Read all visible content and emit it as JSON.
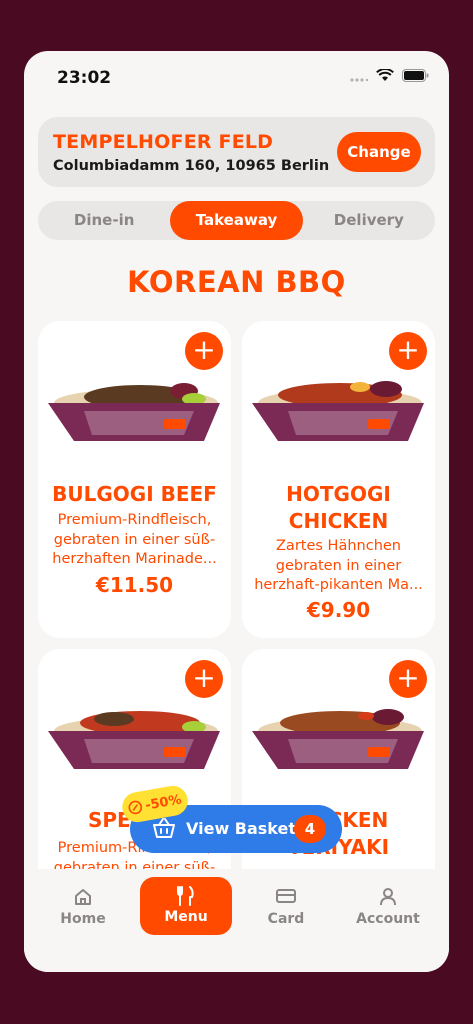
{
  "status": {
    "time": "23:02"
  },
  "location": {
    "name": "TEMPELHOFER FELD",
    "address": "Columbiadamm 160, 10965 Berlin",
    "change_label": "Change"
  },
  "order_modes": [
    {
      "label": "Dine-in",
      "active": false
    },
    {
      "label": "Takeaway",
      "active": true
    },
    {
      "label": "Delivery",
      "active": false
    }
  ],
  "section_title": "KOREAN BBQ",
  "products": [
    {
      "title_lines": [
        "BULGOGI BEEF"
      ],
      "desc_lines": [
        "Premium-Rindfleisch,",
        "gebraten in einer süß-",
        "herzhaften Marinade..."
      ],
      "price": "€11.50",
      "add_icon": "plus-icon"
    },
    {
      "title_lines": [
        "HOTGOGI",
        "CHICKEN"
      ],
      "desc_lines": [
        "Zartes Hähnchen",
        "gebraten in einer",
        "herzhaft-pikanten Ma..."
      ],
      "price": "€9.90",
      "add_icon": "plus-icon"
    },
    {
      "title_lines": [
        "SPECIAL"
      ],
      "desc_lines": [
        "Premium-Rindfleisch,",
        "gebraten in einer süß-"
      ],
      "price": "",
      "add_icon": "plus-icon"
    },
    {
      "title_lines": [
        "CHICKEN",
        "TERIYAKI"
      ],
      "desc_lines": [],
      "price": "",
      "add_icon": "plus-icon"
    }
  ],
  "basket": {
    "label": "View Basket",
    "count": "4",
    "discount": "-50%"
  },
  "tabs": [
    {
      "label": "Home",
      "icon": "home-icon",
      "active": false
    },
    {
      "label": "Menu",
      "icon": "fork-knife-icon",
      "active": true
    },
    {
      "label": "Card",
      "icon": "card-icon",
      "active": false
    },
    {
      "label": "Account",
      "icon": "person-icon",
      "active": false
    }
  ],
  "colors": {
    "accent": "#ff4a00",
    "background": "#4a0a22",
    "basket": "#2f7be8",
    "badge": "#ffe033"
  }
}
